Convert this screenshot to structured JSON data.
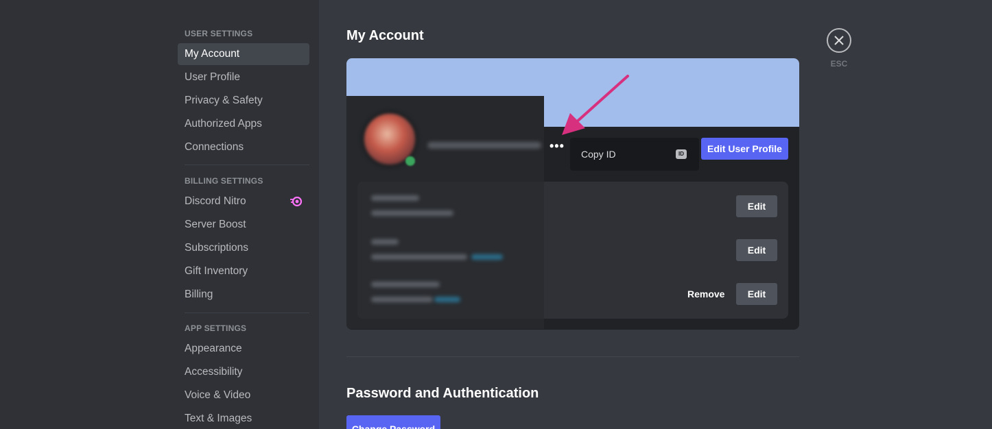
{
  "sidebar": {
    "sections": [
      {
        "header": "USER SETTINGS",
        "items": [
          "My Account",
          "User Profile",
          "Privacy & Safety",
          "Authorized Apps",
          "Connections"
        ]
      },
      {
        "header": "BILLING SETTINGS",
        "items": [
          "Discord Nitro",
          "Server Boost",
          "Subscriptions",
          "Gift Inventory",
          "Billing"
        ]
      },
      {
        "header": "APP SETTINGS",
        "items": [
          "Appearance",
          "Accessibility",
          "Voice & Video",
          "Text & Images"
        ]
      }
    ],
    "selected": "My Account",
    "nitro_icon": "nitro-icon"
  },
  "main": {
    "title": "My Account",
    "more_label": "•••",
    "context_menu": {
      "copy_id_label": "Copy ID",
      "id_icon_text": "ID"
    },
    "edit_profile_label": "Edit User Profile",
    "fields": {
      "edit_label": "Edit",
      "remove_label": "Remove"
    },
    "password_section_title": "Password and Authentication",
    "change_password_label": "Change Password"
  },
  "close": {
    "esc_label": "ESC"
  },
  "colors": {
    "accent": "#5865f2",
    "banner": "#a2bdeb",
    "arrow": "#d6307f",
    "nitro": "#ff73fa"
  }
}
